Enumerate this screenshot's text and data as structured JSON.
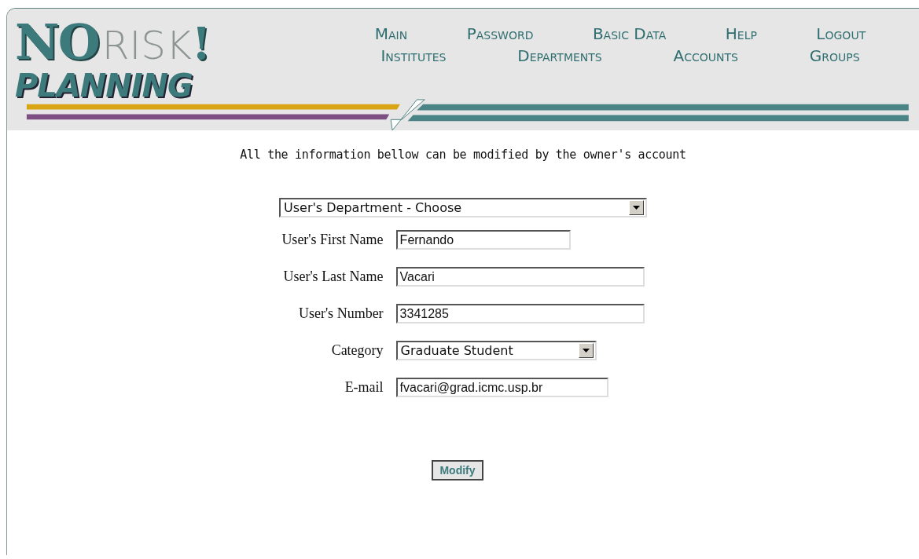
{
  "logo": {
    "no": "NO",
    "risk": "RISK",
    "bang": "!",
    "planning": "PLANNING"
  },
  "nav": [
    "Main",
    "Password",
    "Basic Data",
    "Help",
    "Logout",
    "Institutes",
    "Departments",
    "Accounts",
    "Groups"
  ],
  "notice": "All the information bellow can be modified by the owner's account",
  "department": {
    "value": "User's Department - Choose"
  },
  "fields": [
    {
      "label": "User's First Name",
      "kind": "text",
      "value": "Fernando"
    },
    {
      "label": "User's Last Name",
      "kind": "text",
      "value": "Vacari"
    },
    {
      "label": "User's Number",
      "kind": "text",
      "value": "3341285"
    },
    {
      "label": "Category",
      "kind": "select",
      "value": "Graduate Student"
    },
    {
      "label": "E-mail",
      "kind": "text",
      "value": "fvacari@grad.icmc.usp.br"
    }
  ],
  "submit": "Modify"
}
